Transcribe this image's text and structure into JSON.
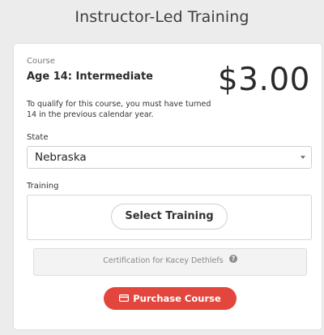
{
  "header": {
    "title": "Instructor-Led Training"
  },
  "course": {
    "label": "Course",
    "name": "Age 14: Intermediate",
    "price": "$3.00",
    "qualify_text": "To qualify for this course, you must have turned 14 in the previous calendar year."
  },
  "state": {
    "label": "State",
    "selected": "Nebraska"
  },
  "training": {
    "label": "Training",
    "select_button": "Select Training"
  },
  "certification": {
    "text": "Certification for Kacey Dethlefs",
    "icon": "help-circle-icon"
  },
  "purchase": {
    "label": "Purchase Course",
    "icon": "credit-card-icon"
  },
  "colors": {
    "accent": "#e2463d",
    "background": "#ececec",
    "card": "#ffffff"
  }
}
